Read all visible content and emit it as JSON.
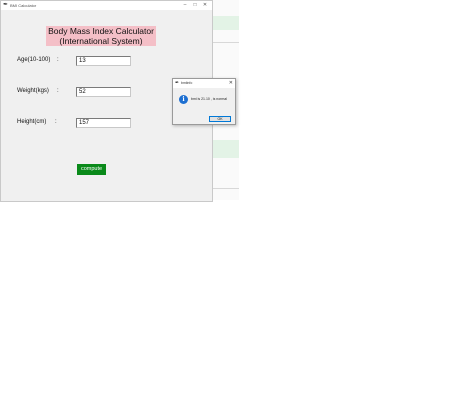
{
  "main_window": {
    "title": "BMI Calculator",
    "controls": {
      "minimize": "–",
      "maximize": "□",
      "close": "✕"
    },
    "heading_line1": "Body Mass Index Calculator",
    "heading_line2": "(International System)",
    "fields": [
      {
        "label": "Age(10-100)",
        "colon": ":",
        "value": "13"
      },
      {
        "label": "Weight(kgs)",
        "colon": ":",
        "value": "52"
      },
      {
        "label": "Height(cm)",
        "colon": ":",
        "value": "157"
      }
    ],
    "compute_label": "compute",
    "heading_bg": "#f4bfc7",
    "button_bg": "#0a8a1a"
  },
  "message_box": {
    "title": "bmiinfo",
    "close": "✕",
    "icon": "info-icon",
    "message": "bmi is 21.10 , is normal",
    "ok_label": "OK"
  }
}
